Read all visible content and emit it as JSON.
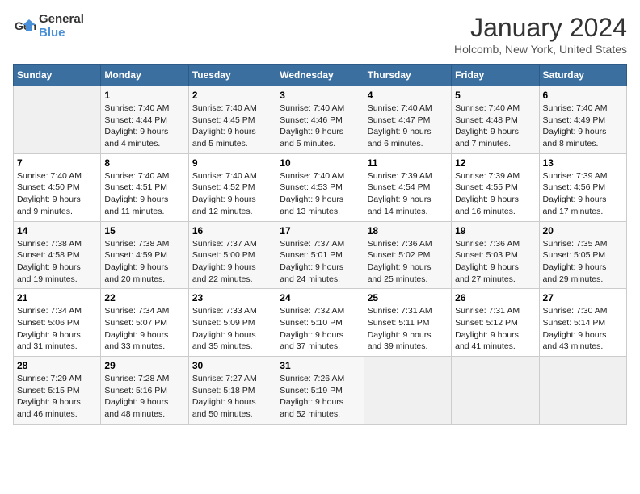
{
  "logo": {
    "line1": "General",
    "line2": "Blue"
  },
  "title": "January 2024",
  "subtitle": "Holcomb, New York, United States",
  "days_of_week": [
    "Sunday",
    "Monday",
    "Tuesday",
    "Wednesday",
    "Thursday",
    "Friday",
    "Saturday"
  ],
  "weeks": [
    [
      {
        "num": "",
        "info": ""
      },
      {
        "num": "1",
        "info": "Sunrise: 7:40 AM\nSunset: 4:44 PM\nDaylight: 9 hours\nand 4 minutes."
      },
      {
        "num": "2",
        "info": "Sunrise: 7:40 AM\nSunset: 4:45 PM\nDaylight: 9 hours\nand 5 minutes."
      },
      {
        "num": "3",
        "info": "Sunrise: 7:40 AM\nSunset: 4:46 PM\nDaylight: 9 hours\nand 5 minutes."
      },
      {
        "num": "4",
        "info": "Sunrise: 7:40 AM\nSunset: 4:47 PM\nDaylight: 9 hours\nand 6 minutes."
      },
      {
        "num": "5",
        "info": "Sunrise: 7:40 AM\nSunset: 4:48 PM\nDaylight: 9 hours\nand 7 minutes."
      },
      {
        "num": "6",
        "info": "Sunrise: 7:40 AM\nSunset: 4:49 PM\nDaylight: 9 hours\nand 8 minutes."
      }
    ],
    [
      {
        "num": "7",
        "info": "Sunrise: 7:40 AM\nSunset: 4:50 PM\nDaylight: 9 hours\nand 9 minutes."
      },
      {
        "num": "8",
        "info": "Sunrise: 7:40 AM\nSunset: 4:51 PM\nDaylight: 9 hours\nand 11 minutes."
      },
      {
        "num": "9",
        "info": "Sunrise: 7:40 AM\nSunset: 4:52 PM\nDaylight: 9 hours\nand 12 minutes."
      },
      {
        "num": "10",
        "info": "Sunrise: 7:40 AM\nSunset: 4:53 PM\nDaylight: 9 hours\nand 13 minutes."
      },
      {
        "num": "11",
        "info": "Sunrise: 7:39 AM\nSunset: 4:54 PM\nDaylight: 9 hours\nand 14 minutes."
      },
      {
        "num": "12",
        "info": "Sunrise: 7:39 AM\nSunset: 4:55 PM\nDaylight: 9 hours\nand 16 minutes."
      },
      {
        "num": "13",
        "info": "Sunrise: 7:39 AM\nSunset: 4:56 PM\nDaylight: 9 hours\nand 17 minutes."
      }
    ],
    [
      {
        "num": "14",
        "info": "Sunrise: 7:38 AM\nSunset: 4:58 PM\nDaylight: 9 hours\nand 19 minutes."
      },
      {
        "num": "15",
        "info": "Sunrise: 7:38 AM\nSunset: 4:59 PM\nDaylight: 9 hours\nand 20 minutes."
      },
      {
        "num": "16",
        "info": "Sunrise: 7:37 AM\nSunset: 5:00 PM\nDaylight: 9 hours\nand 22 minutes."
      },
      {
        "num": "17",
        "info": "Sunrise: 7:37 AM\nSunset: 5:01 PM\nDaylight: 9 hours\nand 24 minutes."
      },
      {
        "num": "18",
        "info": "Sunrise: 7:36 AM\nSunset: 5:02 PM\nDaylight: 9 hours\nand 25 minutes."
      },
      {
        "num": "19",
        "info": "Sunrise: 7:36 AM\nSunset: 5:03 PM\nDaylight: 9 hours\nand 27 minutes."
      },
      {
        "num": "20",
        "info": "Sunrise: 7:35 AM\nSunset: 5:05 PM\nDaylight: 9 hours\nand 29 minutes."
      }
    ],
    [
      {
        "num": "21",
        "info": "Sunrise: 7:34 AM\nSunset: 5:06 PM\nDaylight: 9 hours\nand 31 minutes."
      },
      {
        "num": "22",
        "info": "Sunrise: 7:34 AM\nSunset: 5:07 PM\nDaylight: 9 hours\nand 33 minutes."
      },
      {
        "num": "23",
        "info": "Sunrise: 7:33 AM\nSunset: 5:09 PM\nDaylight: 9 hours\nand 35 minutes."
      },
      {
        "num": "24",
        "info": "Sunrise: 7:32 AM\nSunset: 5:10 PM\nDaylight: 9 hours\nand 37 minutes."
      },
      {
        "num": "25",
        "info": "Sunrise: 7:31 AM\nSunset: 5:11 PM\nDaylight: 9 hours\nand 39 minutes."
      },
      {
        "num": "26",
        "info": "Sunrise: 7:31 AM\nSunset: 5:12 PM\nDaylight: 9 hours\nand 41 minutes."
      },
      {
        "num": "27",
        "info": "Sunrise: 7:30 AM\nSunset: 5:14 PM\nDaylight: 9 hours\nand 43 minutes."
      }
    ],
    [
      {
        "num": "28",
        "info": "Sunrise: 7:29 AM\nSunset: 5:15 PM\nDaylight: 9 hours\nand 46 minutes."
      },
      {
        "num": "29",
        "info": "Sunrise: 7:28 AM\nSunset: 5:16 PM\nDaylight: 9 hours\nand 48 minutes."
      },
      {
        "num": "30",
        "info": "Sunrise: 7:27 AM\nSunset: 5:18 PM\nDaylight: 9 hours\nand 50 minutes."
      },
      {
        "num": "31",
        "info": "Sunrise: 7:26 AM\nSunset: 5:19 PM\nDaylight: 9 hours\nand 52 minutes."
      },
      {
        "num": "",
        "info": ""
      },
      {
        "num": "",
        "info": ""
      },
      {
        "num": "",
        "info": ""
      }
    ]
  ]
}
